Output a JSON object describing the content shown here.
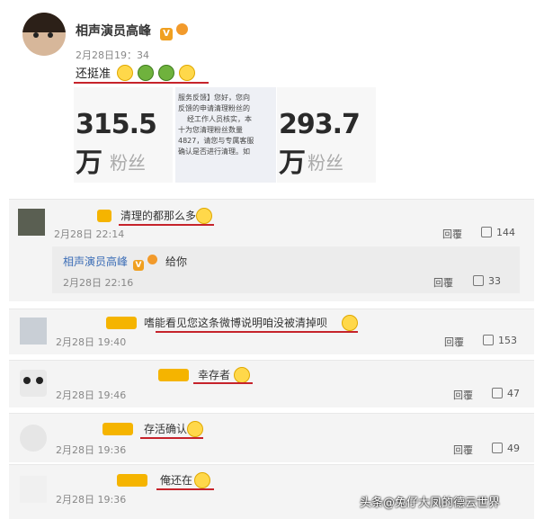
{
  "post": {
    "author": "相声演员高峰",
    "time": "2月28日19：34",
    "text": "还挺准",
    "stats": [
      {
        "value": "315.5万",
        "label": "粉丝"
      },
      {
        "value": "293.7万",
        "label": "粉丝"
      }
    ],
    "notice_lines": [
      "服务反馈】您好，您向",
      "反馈的申请清理粉丝的",
      "经工作人员核实，本",
      "十为您清理粉丝数量",
      "4827，请您与专属客服",
      "确认是否进行清理。如"
    ]
  },
  "comments": [
    {
      "text": "清理的都那么多",
      "time": "2月28日 22:14",
      "reply": "回覆",
      "likes": "144"
    },
    {
      "text": "嗜能看见您这条微博说明咱没被清掉呗",
      "time": "2月28日 19:40",
      "reply": "回覆",
      "likes": "153"
    },
    {
      "text": "幸存者",
      "time": "2月28日 19:46",
      "reply": "回覆",
      "likes": "47"
    },
    {
      "text": "存活确认",
      "time": "2月28日 19:36",
      "reply": "回覆",
      "likes": "49"
    },
    {
      "text": "俺还在",
      "time": "2月28日 19:36",
      "reply": "",
      "likes": ""
    }
  ],
  "subreply": {
    "author": "相声演员高峰",
    "text": "给你",
    "time": "2月28日 22:16",
    "reply": "回覆",
    "likes": "33"
  },
  "watermark": "头条@兔仔大凤的德云世界"
}
